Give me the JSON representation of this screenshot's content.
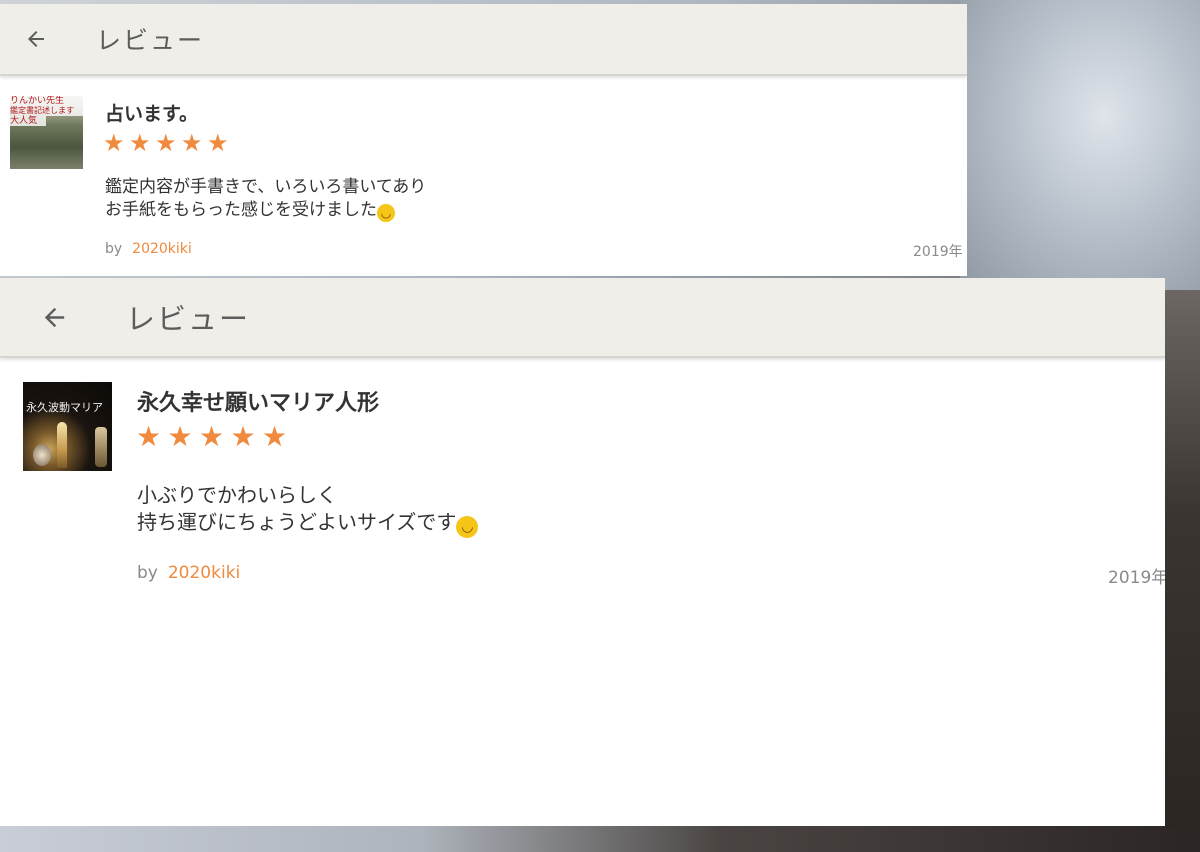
{
  "screens": [
    {
      "appbar": {
        "back_icon": "arrow-back-icon",
        "title": "レビュー"
      },
      "review": {
        "thumbnail_text": [
          "りんかい先生",
          "鑑定書記述します",
          "大人気"
        ],
        "title": "占います。",
        "rating": 5,
        "stars": [
          "★",
          "★",
          "★",
          "★",
          "★"
        ],
        "body_lines": [
          "鑑定内容が手書きで、いろいろ書いてあり",
          "お手紙をもらった感じを受けました"
        ],
        "emoji": "smiling-face-emoji",
        "by_label": "by",
        "author": "2020kiki",
        "date": "2019年"
      }
    },
    {
      "appbar": {
        "back_icon": "arrow-back-icon",
        "title": "レビュー"
      },
      "review": {
        "thumbnail_text": [
          "永久波動マリア"
        ],
        "title": "永久幸せ願いマリア人形",
        "rating": 5,
        "stars": [
          "★",
          "★",
          "★",
          "★",
          "★"
        ],
        "body_lines": [
          "小ぶりでかわいらしく",
          "持ち運びにちょうどよいサイズです"
        ],
        "emoji": "smiling-face-emoji",
        "by_label": "by",
        "author": "2020kiki",
        "date": "2019年"
      }
    }
  ],
  "colors": {
    "accent": "#f08a3c",
    "appbar_bg": "#efeee8",
    "text": "#333333",
    "muted": "#8a8a8a"
  }
}
